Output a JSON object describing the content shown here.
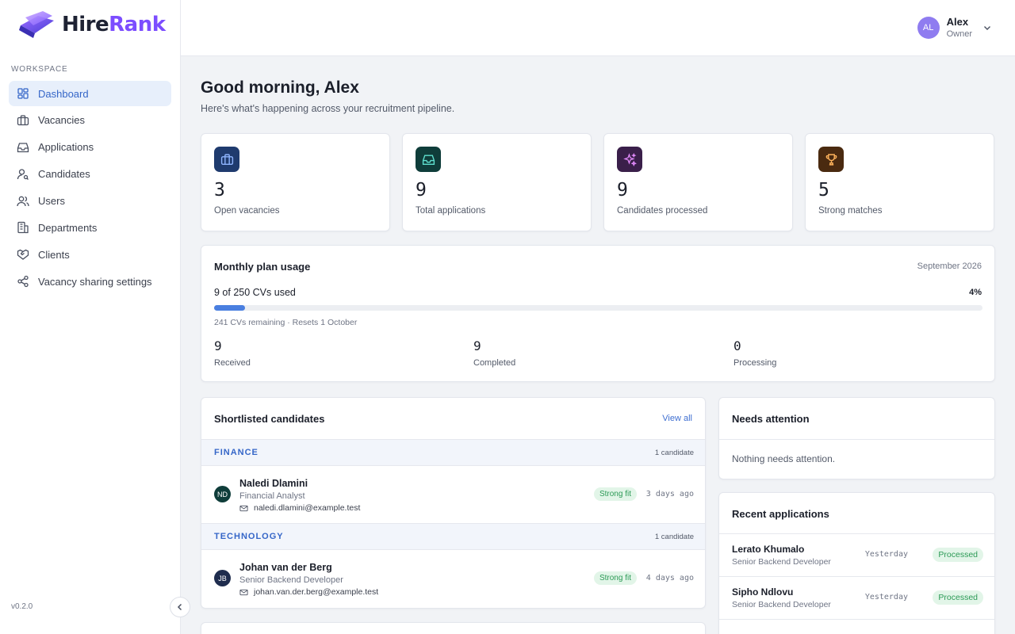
{
  "brand": {
    "name_part1": "Hire",
    "name_part2": "Rank",
    "version": "v0.2.0"
  },
  "sidebar": {
    "section_label": "WORKSPACE",
    "items": [
      {
        "label": "Dashboard",
        "icon": "dashboard-icon",
        "active": true
      },
      {
        "label": "Vacancies",
        "icon": "briefcase-icon"
      },
      {
        "label": "Applications",
        "icon": "inbox-icon"
      },
      {
        "label": "Candidates",
        "icon": "user-search-icon"
      },
      {
        "label": "Users",
        "icon": "users-icon"
      },
      {
        "label": "Departments",
        "icon": "building-icon"
      },
      {
        "label": "Clients",
        "icon": "handshake-icon"
      },
      {
        "label": "Vacancy sharing settings",
        "icon": "share-icon"
      }
    ]
  },
  "user": {
    "initials": "AL",
    "name": "Alex",
    "role": "Owner"
  },
  "header": {
    "greeting": "Good morning, Alex",
    "subtitle": "Here's what's happening across your recruitment pipeline."
  },
  "stats": [
    {
      "value": "3",
      "label": "Open vacancies",
      "icon": "briefcase-icon",
      "color": "#1f3b6e"
    },
    {
      "value": "9",
      "label": "Total applications",
      "icon": "inbox-icon",
      "color": "#0f3d3a"
    },
    {
      "value": "9",
      "label": "Candidates processed",
      "icon": "sparkles-icon",
      "color": "#3a1f4a"
    },
    {
      "value": "5",
      "label": "Strong matches",
      "icon": "trophy-icon",
      "color": "#4a2a10"
    }
  ],
  "usage": {
    "title": "Monthly plan usage",
    "month": "September 2026",
    "used_text": "9 of 250 CVs used",
    "percent_text": "4%",
    "progress": 0.04,
    "remaining_text": "241 CVs remaining · Resets 1 October",
    "metrics": [
      {
        "value": "9",
        "label": "Received"
      },
      {
        "value": "9",
        "label": "Completed"
      },
      {
        "value": "0",
        "label": "Processing"
      }
    ]
  },
  "shortlist": {
    "title": "Shortlisted candidates",
    "view_all": "View all",
    "groups": [
      {
        "name": "FINANCE",
        "count": "1 candidate",
        "candidate": {
          "initials": "ND",
          "avatar_color": "#0f3d3a",
          "name": "Naledi Dlamini",
          "role": "Financial Analyst",
          "email": "naledi.dlamini@example.test",
          "badge": "Strong fit",
          "time": "3 days ago"
        }
      },
      {
        "name": "TECHNOLOGY",
        "count": "1 candidate",
        "candidate": {
          "initials": "JB",
          "avatar_color": "#1f2d4e",
          "name": "Johan van der Berg",
          "role": "Senior Backend Developer",
          "email": "johan.van.der.berg@example.test",
          "badge": "Strong fit",
          "time": "4 days ago"
        }
      }
    ]
  },
  "attention": {
    "title": "Needs attention",
    "empty": "Nothing needs attention."
  },
  "recent": {
    "title": "Recent applications",
    "rows": [
      {
        "name": "Lerato Khumalo",
        "role": "Senior Backend Developer",
        "time": "Yesterday",
        "status": "Processed"
      },
      {
        "name": "Sipho Ndlovu",
        "role": "Senior Backend Developer",
        "time": "Yesterday",
        "status": "Processed"
      }
    ]
  }
}
